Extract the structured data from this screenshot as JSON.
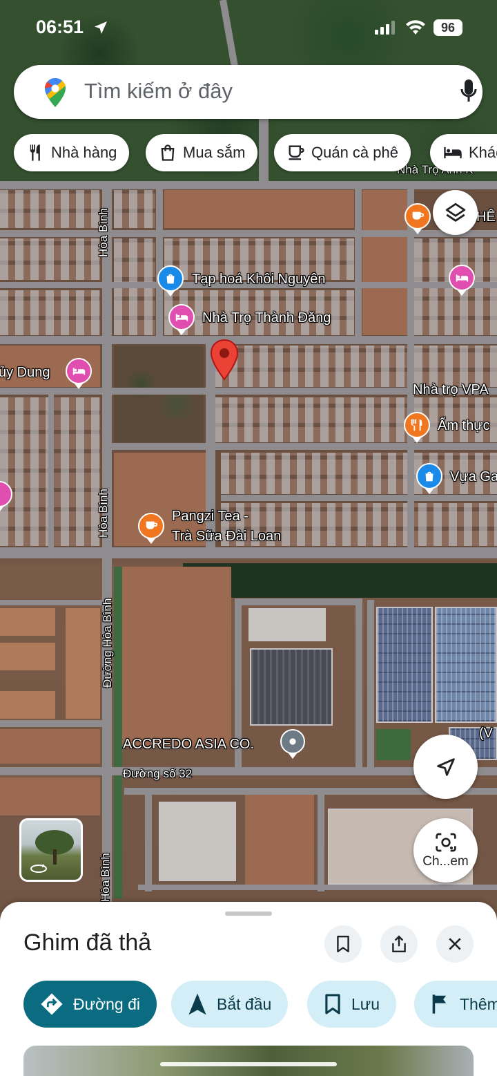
{
  "status_bar": {
    "time": "06:51",
    "battery": "96"
  },
  "search": {
    "placeholder": "Tìm kiếm ở đây"
  },
  "chips": [
    {
      "label": "Nhà hàng",
      "icon": "utensils-icon"
    },
    {
      "label": "Mua sắm",
      "icon": "shopping-bag-icon"
    },
    {
      "label": "Quán cà phê",
      "icon": "coffee-icon"
    },
    {
      "label": "Khác",
      "icon": "bed-icon"
    }
  ],
  "map": {
    "labels": {
      "hoa_binh_1": "Hòa Bình",
      "hoa_binh_2": "Hòa Bình",
      "duong_hoa_binh": "Đường Hòa Bình",
      "hoa_binh_3": "Hòa Bình",
      "duong_so_32": "Đường số 32",
      "top_right": "Nhà Trọ Anh K",
      "he": "HÊ"
    },
    "pois": {
      "tap_hoa": "Tạp hoá Khôi Nguyên",
      "nha_tro_thanh_dang": "Nhà Trọ Thành Đăng",
      "uy_dung": "ủy Dung",
      "nha_tro_vpa": "Nhà trọ VPA",
      "am_thuc": "Ẩm thực",
      "vua_ga": "Vựa Ga",
      "pangzi_1": "Pangzi Tea -",
      "pangzi_2": "Trà Sữa Đài Loan",
      "accredo": "ACCREDO ASIA CO.",
      "v_label": "(V"
    }
  },
  "controls": {
    "lens_label": "Ch...em"
  },
  "sheet": {
    "title": "Ghim đã thả",
    "actions": [
      {
        "label": "Đường đi",
        "icon": "directions-icon"
      },
      {
        "label": "Bắt đầu",
        "icon": "navigation-arrow-icon"
      },
      {
        "label": "Lưu",
        "icon": "bookmark-icon"
      },
      {
        "label": "Thêm",
        "icon": "flag-icon"
      }
    ]
  },
  "colors": {
    "accent": "#0b6b80",
    "chip_bg": "#d3eef7",
    "pin_red": "#ea4335"
  }
}
